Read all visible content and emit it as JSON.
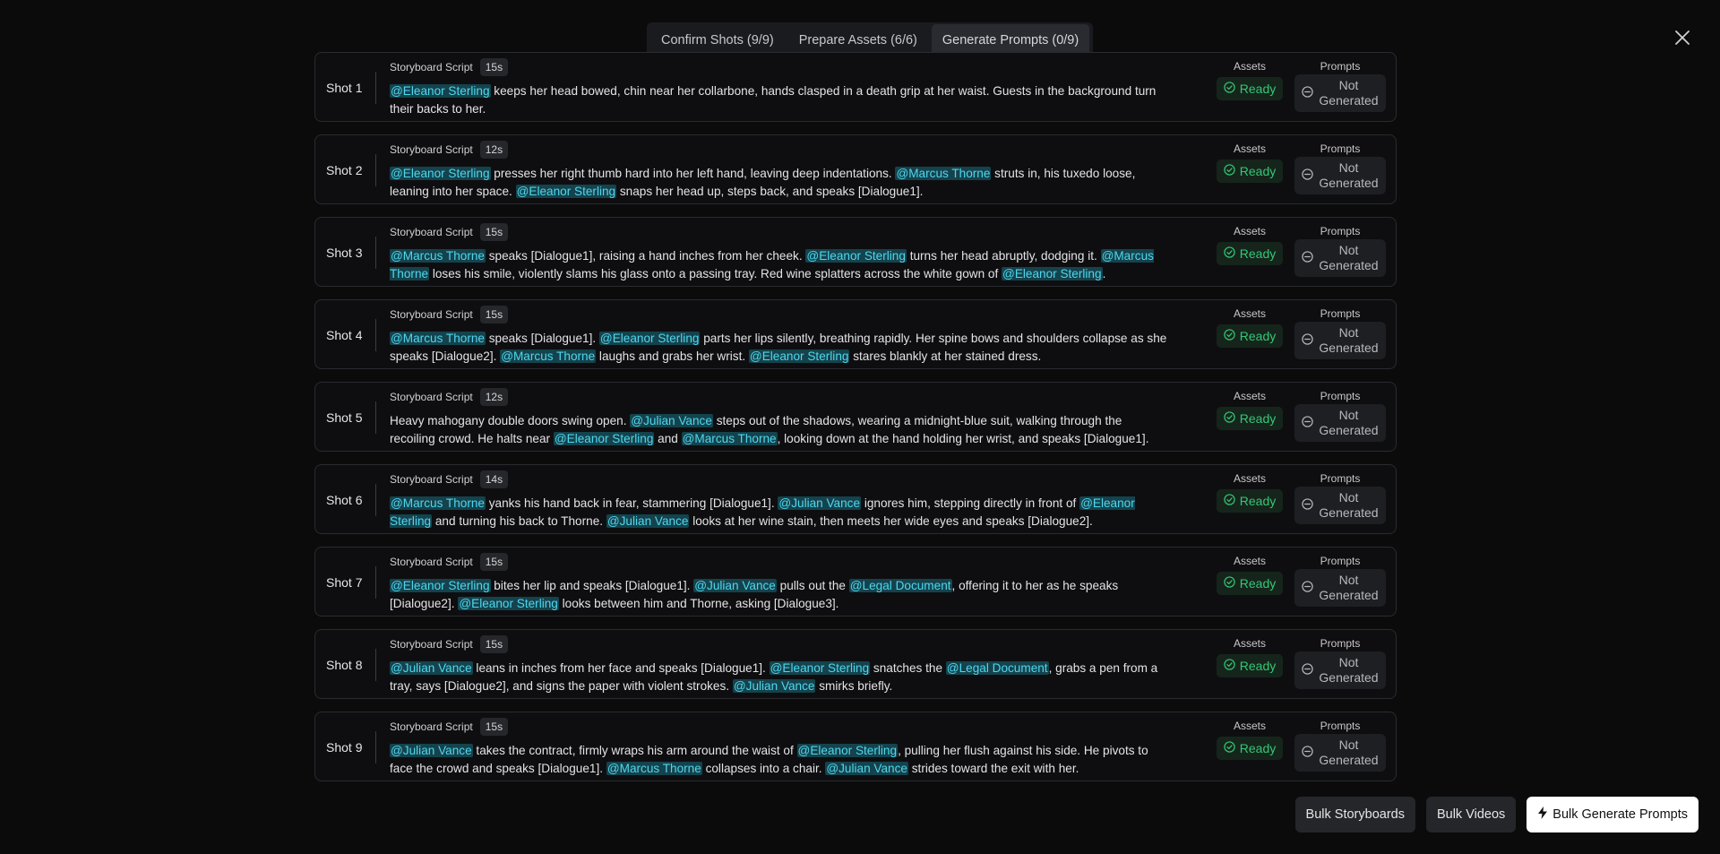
{
  "tabs": [
    {
      "label": "Confirm Shots (9/9)",
      "active": false
    },
    {
      "label": "Prepare Assets (6/6)",
      "active": false
    },
    {
      "label": "Generate Prompts (0/9)",
      "active": true
    }
  ],
  "labels": {
    "script": "Storyboard Script",
    "assets": "Assets",
    "prompts": "Prompts",
    "ready": "Ready",
    "not_generated_1": "Not",
    "not_generated_2": "Generated"
  },
  "shots": [
    {
      "name": "Shot 1",
      "duration": "15s",
      "segments": [
        {
          "m": "@Eleanor Sterling"
        },
        {
          "t": " keeps her head bowed, chin near her collarbone, hands clasped in a death grip at her waist. Guests in the background turn their backs to her."
        }
      ]
    },
    {
      "name": "Shot 2",
      "duration": "12s",
      "segments": [
        {
          "m": "@Eleanor Sterling"
        },
        {
          "t": " presses her right thumb hard into her left hand, leaving deep indentations. "
        },
        {
          "m": "@Marcus Thorne"
        },
        {
          "t": " struts in, his tuxedo loose, leaning into her space. "
        },
        {
          "m": "@Eleanor Sterling"
        },
        {
          "t": " snaps her head up, steps back, and speaks [Dialogue1]."
        }
      ]
    },
    {
      "name": "Shot 3",
      "duration": "15s",
      "segments": [
        {
          "m": "@Marcus Thorne"
        },
        {
          "t": " speaks [Dialogue1], raising a hand inches from her cheek. "
        },
        {
          "m": "@Eleanor Sterling"
        },
        {
          "t": " turns her head abruptly, dodging it. "
        },
        {
          "m": "@Marcus Thorne"
        },
        {
          "t": " loses his smile, violently slams his glass onto a passing tray. Red wine splatters across the white gown of "
        },
        {
          "m": "@Eleanor Sterling"
        },
        {
          "t": "."
        }
      ]
    },
    {
      "name": "Shot 4",
      "duration": "15s",
      "segments": [
        {
          "m": "@Marcus Thorne"
        },
        {
          "t": " speaks [Dialogue1]. "
        },
        {
          "m": "@Eleanor Sterling"
        },
        {
          "t": " parts her lips silently, breathing rapidly. Her spine bows and shoulders collapse as she speaks [Dialogue2]. "
        },
        {
          "m": "@Marcus Thorne"
        },
        {
          "t": " laughs and grabs her wrist. "
        },
        {
          "m": "@Eleanor Sterling"
        },
        {
          "t": " stares blankly at her stained dress."
        }
      ]
    },
    {
      "name": "Shot 5",
      "duration": "12s",
      "segments": [
        {
          "t": "Heavy mahogany double doors swing open. "
        },
        {
          "m": "@Julian Vance"
        },
        {
          "t": " steps out of the shadows, wearing a midnight-blue suit, walking through the recoiling crowd. He halts near "
        },
        {
          "m": "@Eleanor Sterling"
        },
        {
          "t": " and "
        },
        {
          "m": "@Marcus Thorne"
        },
        {
          "t": ", looking down at the hand holding her wrist, and speaks [Dialogue1]."
        }
      ]
    },
    {
      "name": "Shot 6",
      "duration": "14s",
      "segments": [
        {
          "m": "@Marcus Thorne"
        },
        {
          "t": " yanks his hand back in fear, stammering [Dialogue1]. "
        },
        {
          "m": "@Julian Vance"
        },
        {
          "t": " ignores him, stepping directly in front of "
        },
        {
          "m": "@Eleanor Sterling"
        },
        {
          "t": " and turning his back to Thorne. "
        },
        {
          "m": "@Julian Vance"
        },
        {
          "t": " looks at her wine stain, then meets her wide eyes and speaks [Dialogue2]."
        }
      ]
    },
    {
      "name": "Shot 7",
      "duration": "15s",
      "segments": [
        {
          "m": "@Eleanor Sterling"
        },
        {
          "t": " bites her lip and speaks [Dialogue1]. "
        },
        {
          "m": "@Julian Vance"
        },
        {
          "t": " pulls out the "
        },
        {
          "m": "@Legal Document"
        },
        {
          "t": ", offering it to her as he speaks [Dialogue2]. "
        },
        {
          "m": "@Eleanor Sterling"
        },
        {
          "t": " looks between him and Thorne, asking [Dialogue3]."
        }
      ]
    },
    {
      "name": "Shot 8",
      "duration": "15s",
      "segments": [
        {
          "m": "@Julian Vance"
        },
        {
          "t": " leans in inches from her face and speaks [Dialogue1]. "
        },
        {
          "m": "@Eleanor Sterling"
        },
        {
          "t": " snatches the "
        },
        {
          "m": "@Legal Document"
        },
        {
          "t": ", grabs a pen from a tray, says [Dialogue2], and signs the paper with violent strokes. "
        },
        {
          "m": "@Julian Vance"
        },
        {
          "t": " smirks briefly."
        }
      ]
    },
    {
      "name": "Shot 9",
      "duration": "15s",
      "segments": [
        {
          "m": "@Julian Vance"
        },
        {
          "t": " takes the contract, firmly wraps his arm around the waist of "
        },
        {
          "m": "@Eleanor Sterling"
        },
        {
          "t": ", pulling her flush against his side. He pivots to face the crowd and speaks [Dialogue1]. "
        },
        {
          "m": "@Marcus Thorne"
        },
        {
          "t": " collapses into a chair. "
        },
        {
          "m": "@Julian Vance"
        },
        {
          "t": " strides toward the exit with her."
        }
      ]
    }
  ],
  "buttons": {
    "bulk_storyboards": "Bulk Storyboards",
    "bulk_videos": "Bulk Videos",
    "bulk_generate_prompts": "Bulk Generate Prompts"
  },
  "colors": {
    "mention_bg": "#14434d",
    "mention_text": "#4fd7ee",
    "ready_green": "#34c777"
  }
}
